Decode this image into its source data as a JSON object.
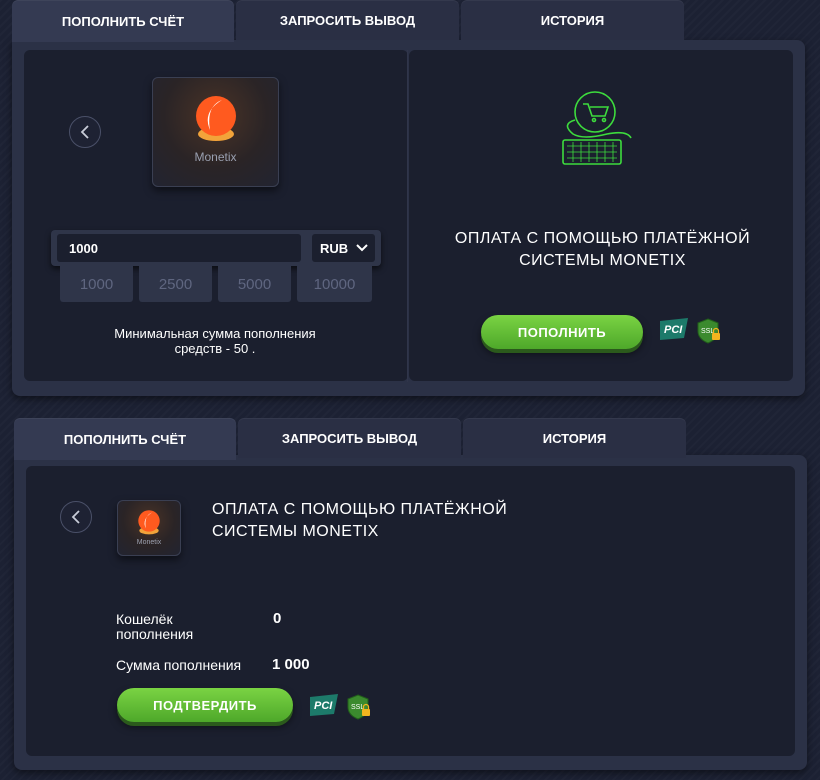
{
  "tabs": [
    {
      "label": "ПОПОЛНИТЬ СЧЁТ"
    },
    {
      "label": "ЗАПРОСИТЬ ВЫВОД"
    },
    {
      "label": "ИСТОРИЯ"
    }
  ],
  "deposit": {
    "provider_name": "Monetix",
    "amount_value": "1000",
    "currency": "RUB",
    "presets": [
      "1000",
      "2500",
      "5000",
      "10000"
    ],
    "min_text_line1": "Минимальная сумма пополнения",
    "min_text_line2": "средств - 50  .",
    "title_line1": "ОПЛАТА С ПОМОЩЬЮ ПЛАТЁЖНОЙ",
    "title_line2": "СИСТЕМЫ MONETIX",
    "submit_label": "ПОПОЛНИТЬ",
    "pci_label": "PCI",
    "ssl_label": "SSL"
  },
  "confirm": {
    "provider_name": "Monetix",
    "title_line1": "ОПЛАТА С ПОМОЩЬЮ ПЛАТЁЖНОЙ",
    "title_line2": "СИСТЕМЫ MONETIX",
    "wallet_label_line1": "Кошелёк",
    "wallet_label_line2": "пополнения",
    "wallet_value": "0",
    "amount_label": "Сумма пополнения",
    "amount_value": "1 000",
    "submit_label": "ПОДТВЕРДИТЬ",
    "pci_label": "PCI",
    "ssl_label": "SSL"
  },
  "colors": {
    "accent_green": "#5fbf33",
    "cart_icon_green": "#3ddc3d",
    "logo_orange": "#ff5a1f"
  }
}
